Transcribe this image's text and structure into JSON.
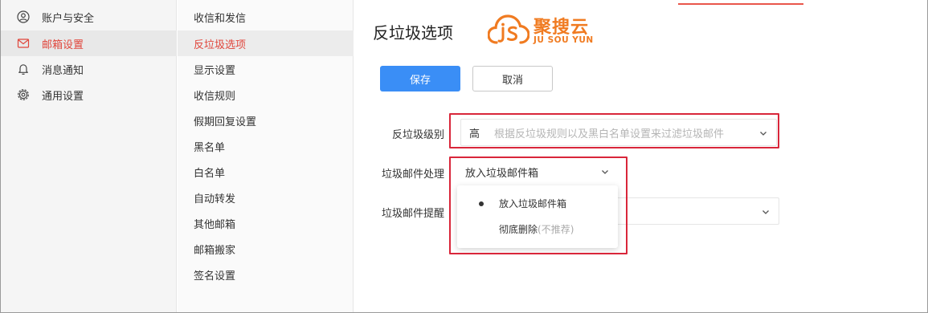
{
  "sidebar": {
    "items": [
      {
        "label": "账户与安全",
        "icon": "user-icon"
      },
      {
        "label": "邮箱设置",
        "icon": "mail-icon"
      },
      {
        "label": "消息通知",
        "icon": "bell-icon"
      },
      {
        "label": "通用设置",
        "icon": "gear-icon"
      }
    ]
  },
  "subnav": {
    "items": [
      {
        "label": "收信和发信"
      },
      {
        "label": "反垃圾选项"
      },
      {
        "label": "显示设置"
      },
      {
        "label": "收信规则"
      },
      {
        "label": "假期回复设置"
      },
      {
        "label": "黑名单"
      },
      {
        "label": "白名单"
      },
      {
        "label": "自动转发"
      },
      {
        "label": "其他邮箱"
      },
      {
        "label": "邮箱搬家"
      },
      {
        "label": "签名设置"
      }
    ]
  },
  "main": {
    "title": "反垃圾选项",
    "logo": {
      "cn": "聚搜云",
      "en": "JU SOU YUN"
    },
    "save_label": "保存",
    "cancel_label": "取消",
    "level": {
      "label": "反垃圾级别",
      "value": "高",
      "hint": "根据反垃圾规则以及黑白名单设置来过滤垃圾邮件"
    },
    "handling": {
      "label": "垃圾邮件处理",
      "value": "放入垃圾邮件箱"
    },
    "reminder": {
      "label": "垃圾邮件提醒"
    },
    "dropdown": {
      "options": [
        {
          "label": "放入垃圾邮件箱",
          "note": ""
        },
        {
          "label": "彻底删除",
          "note": "(不推荐)"
        }
      ]
    }
  },
  "colors": {
    "accent": "#e0463c",
    "primary": "#3a8ef6",
    "highlight": "#d9263a",
    "logo": "#f07b21"
  }
}
